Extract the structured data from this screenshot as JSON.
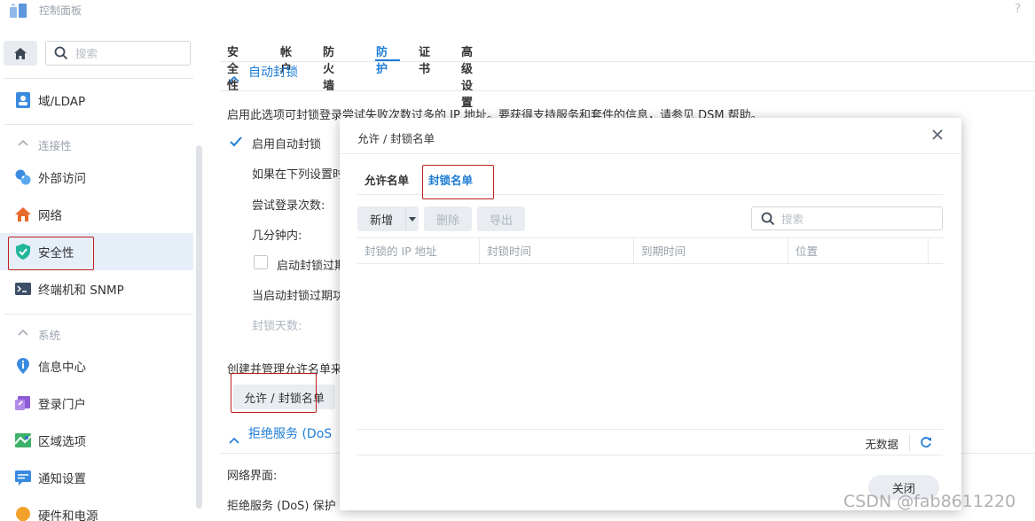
{
  "app": {
    "title": "控制面板",
    "help": "?"
  },
  "sidebar": {
    "search_placeholder": "搜索",
    "items": [
      {
        "label": "域/LDAP"
      },
      {
        "label": "外部访问"
      },
      {
        "label": "网络"
      },
      {
        "label": "安全性"
      },
      {
        "label": "终端机和 SNMP"
      },
      {
        "label": "信息中心"
      },
      {
        "label": "登录门户"
      },
      {
        "label": "区域选项"
      },
      {
        "label": "通知设置"
      },
      {
        "label": "硬件和电源"
      }
    ],
    "groups": [
      {
        "label": "连接性"
      },
      {
        "label": "系统"
      }
    ]
  },
  "main": {
    "tabs": [
      {
        "label": "安全性"
      },
      {
        "label": "帐户"
      },
      {
        "label": "防火墙"
      },
      {
        "label": "防护"
      },
      {
        "label": "证书"
      },
      {
        "label": "高级设置"
      }
    ],
    "active_tab": "防护",
    "auto_block": {
      "header": "自动封锁",
      "description": "启用此选项可封锁登录尝试失败次数过多的 IP 地址。要获得支持服务和套件的信息，请参见 DSM 帮助。",
      "enable_label": "启用自动封锁",
      "condition_label": "如果在下列设置时",
      "attempts_label": "尝试登录次数:",
      "minutes_label": "几分钟内:",
      "expire_checkbox_label": "启动封锁过期",
      "expire_note": "当启动封锁过期功",
      "block_days_label": "封锁天数:",
      "manage_text": "创建并管理允许名单来",
      "manage_button": "允许 / 封锁名单"
    },
    "dos": {
      "header": "拒绝服务 (DoS",
      "interface_label": "网络界面:",
      "protect_label": "拒绝服务 (DoS) 保护"
    }
  },
  "dialog": {
    "title": "允许 / 封锁名单",
    "tabs": [
      {
        "label": "允许名单"
      },
      {
        "label": "封锁名单"
      }
    ],
    "active_tab": "封锁名单",
    "toolbar": {
      "add": "新增",
      "delete": "删除",
      "export": "导出",
      "search_placeholder": "搜索"
    },
    "columns": [
      "封锁的 IP 地址",
      "封锁时间",
      "到期时间",
      "位置"
    ],
    "no_data": "无数据",
    "close_button": "关闭"
  },
  "watermark": "CSDN @fab8611220",
  "colors": {
    "accent": "#1d7cd6",
    "highlight": "#c01d1d",
    "active_bg": "#e6eef8"
  }
}
